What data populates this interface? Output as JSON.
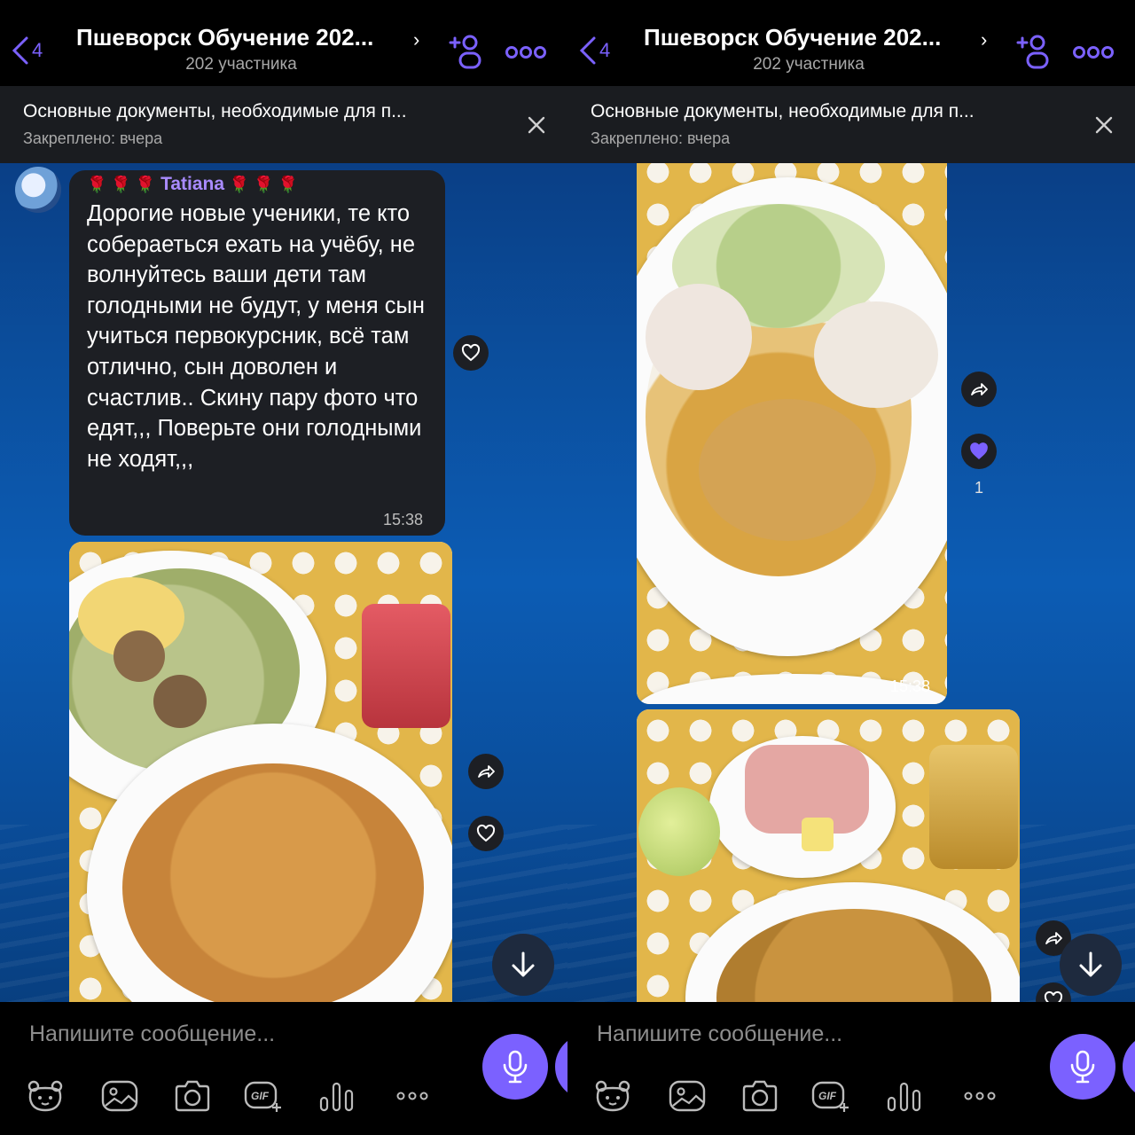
{
  "screens": [
    {
      "header": {
        "back_count": "4",
        "title": "Пшеворск Обучение 202...",
        "subtitle": "202 участника"
      },
      "pinned": {
        "title": "Основные документы, необходимые для п...",
        "subtitle": "Закреплено: вчера"
      },
      "message": {
        "sender": "Tatiana",
        "roses": "🌹 🌹 🌹",
        "text": "Дорогие новые ученики, те кто собераеться ехать на учёбу, не волнуйтесь ваши дети там голодными не будут, у меня сын учиться первокурсник, всё там отлично, сын доволен и счастлив.. Скину пару фото что едят,,, Поверьте они голодными не ходят,,,",
        "time": "15:38"
      },
      "composer": {
        "placeholder": "Напишите сообщение..."
      },
      "toolbar": {
        "gif_label": "GIF"
      }
    },
    {
      "header": {
        "back_count": "4",
        "title": "Пшеворск Обучение 202...",
        "subtitle": "202 участника"
      },
      "pinned": {
        "title": "Основные документы, необходимые для п...",
        "subtitle": "Закреплено: вчера"
      },
      "photo_time": "15:38",
      "like_count": "1",
      "composer": {
        "placeholder": "Напишите сообщение..."
      },
      "toolbar": {
        "gif_label": "GIF"
      }
    }
  ],
  "colors": {
    "accent": "#7b61ff",
    "bubble": "#1d1f24",
    "header": "#000000",
    "pinned_bar": "#1a1c20"
  },
  "icons": [
    "back-chevron-icon",
    "chevron-right-icon",
    "add-participant-icon",
    "more-icon",
    "close-icon",
    "heart-icon",
    "share-icon",
    "arrow-down-icon",
    "microphone-icon",
    "sticker-icon",
    "gallery-icon",
    "camera-icon",
    "gif-icon",
    "poll-icon"
  ]
}
